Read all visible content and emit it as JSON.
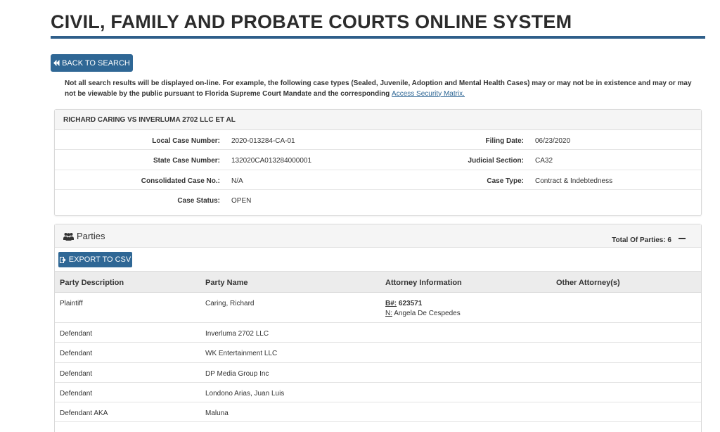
{
  "page": {
    "title": "CIVIL, FAMILY AND PROBATE COURTS ONLINE SYSTEM"
  },
  "back_button": {
    "label": "BACK TO SEARCH"
  },
  "notice": {
    "text": "Not all search results will be displayed on-line. For example, the following case types (Sealed, Juvenile, Adoption and Mental Health Cases) may or may not be in existence and may or may not be viewable by the public pursuant to Florida Supreme Court Mandate and the corresponding ",
    "link_text": "Access Security Matrix."
  },
  "case": {
    "title": "RICHARD CARING VS INVERLUMA 2702 LLC ET AL",
    "local_case_number": {
      "label": "Local Case Number:",
      "value": "2020-013284-CA-01"
    },
    "state_case_number": {
      "label": "State Case Number:",
      "value": "132020CA013284000001"
    },
    "consolidated_case_no": {
      "label": "Consolidated Case No.:",
      "value": "N/A"
    },
    "case_status": {
      "label": "Case Status:",
      "value": "OPEN"
    },
    "filing_date": {
      "label": "Filing Date:",
      "value": "06/23/2020"
    },
    "judicial_section": {
      "label": "Judicial Section:",
      "value": "CA32"
    },
    "case_type": {
      "label": "Case Type:",
      "value": "Contract & Indebtedness"
    }
  },
  "parties": {
    "title": "Parties",
    "total_label": "Total Of Parties: 6",
    "export_label": "EXPORT TO CSV",
    "columns": [
      "Party Description",
      "Party Name",
      "Attorney Information",
      "Other Attorney(s)"
    ],
    "rows": [
      {
        "description": "Plaintiff",
        "name": "Caring, Richard",
        "bar_label": "B#:",
        "bar_number": "623571",
        "atty_label": "N:",
        "atty_name": "Angela De Cespedes"
      },
      {
        "description": "Defendant",
        "name": "Inverluma 2702 LLC"
      },
      {
        "description": "Defendant",
        "name": "WK Entertainment LLC"
      },
      {
        "description": "Defendant",
        "name": "DP Media Group Inc"
      },
      {
        "description": "Defendant",
        "name": "Londono Arias, Juan Luis"
      },
      {
        "description": "Defendant AKA",
        "name": "Maluna"
      }
    ]
  },
  "colors": {
    "accent": "#2f6795",
    "rule": "#2f5f8a"
  }
}
